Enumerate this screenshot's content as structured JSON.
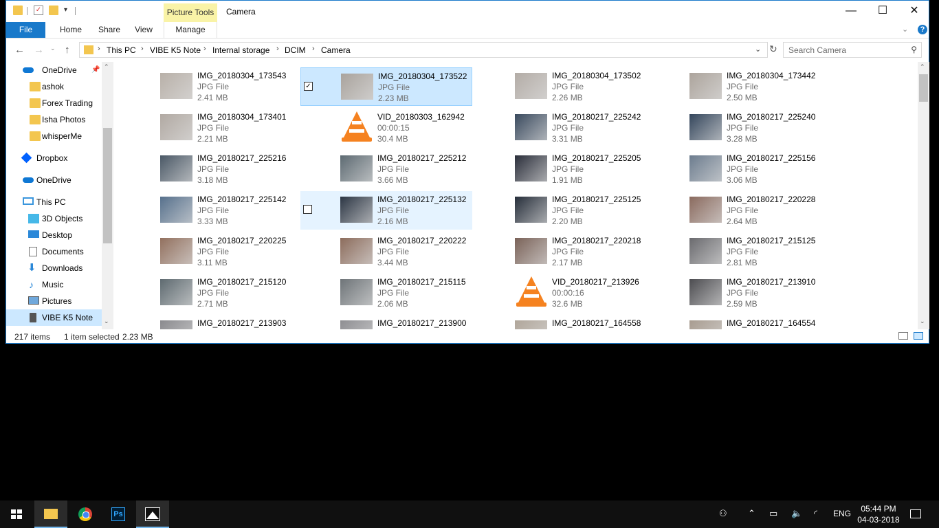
{
  "window": {
    "title": "Camera",
    "context_tab": "Picture Tools",
    "controls": {
      "minimize": "—",
      "maximize": "☐",
      "close": "✕"
    }
  },
  "ribbon": {
    "tabs": [
      "File",
      "Home",
      "Share",
      "View",
      "Manage"
    ]
  },
  "address": {
    "crumbs": [
      "This PC",
      "VIBE K5 Note",
      "Internal storage",
      "DCIM",
      "Camera"
    ],
    "separator": "›"
  },
  "search": {
    "placeholder": "Search Camera"
  },
  "nav": {
    "items": [
      {
        "label": "OneDrive",
        "icon": "cloud-icon",
        "pinned": true
      },
      {
        "label": "ashok",
        "icon": "folder-icon"
      },
      {
        "label": "Forex Trading",
        "icon": "folder-icon"
      },
      {
        "label": "Isha Photos",
        "icon": "folder-icon"
      },
      {
        "label": "whisperMe",
        "icon": "folder-icon"
      },
      {
        "label": "Dropbox",
        "icon": "dropbox-icon"
      },
      {
        "label": "OneDrive",
        "icon": "cloud-icon"
      },
      {
        "label": "This PC",
        "icon": "computer-icon"
      },
      {
        "label": "3D Objects",
        "icon": "cube-icon"
      },
      {
        "label": "Desktop",
        "icon": "desktop-icon"
      },
      {
        "label": "Documents",
        "icon": "document-icon"
      },
      {
        "label": "Downloads",
        "icon": "download-icon"
      },
      {
        "label": "Music",
        "icon": "music-icon"
      },
      {
        "label": "Pictures",
        "icon": "pictures-icon"
      },
      {
        "label": "VIBE K5 Note",
        "icon": "phone-icon",
        "selected": true
      }
    ]
  },
  "files": [
    {
      "name": "IMG_20180304_173543",
      "type": "JPG File",
      "size": "2.41 MB",
      "thumb": "#b8b0a8"
    },
    {
      "name": "IMG_20180304_173522",
      "type": "JPG File",
      "size": "2.23 MB",
      "thumb": "#a9a39d",
      "selected": true
    },
    {
      "name": "IMG_20180304_173502",
      "type": "JPG File",
      "size": "2.26 MB",
      "thumb": "#b3aca6"
    },
    {
      "name": "IMG_20180304_173442",
      "type": "JPG File",
      "size": "2.50 MB",
      "thumb": "#aca49c"
    },
    {
      "name": "IMG_20180304_173401",
      "type": "JPG File",
      "size": "2.21 MB",
      "thumb": "#b1a9a2"
    },
    {
      "name": "VID_20180303_162942",
      "type": "00:00:15",
      "size": "30.4 MB",
      "video": true
    },
    {
      "name": "IMG_20180217_225242",
      "type": "JPG File",
      "size": "3.31 MB",
      "thumb": "#3a4a5e"
    },
    {
      "name": "IMG_20180217_225240",
      "type": "JPG File",
      "size": "3.28 MB",
      "thumb": "#34465c"
    },
    {
      "name": "IMG_20180217_225216",
      "type": "JPG File",
      "size": "3.18 MB",
      "thumb": "#4a5866"
    },
    {
      "name": "IMG_20180217_225212",
      "type": "JPG File",
      "size": "3.66 MB",
      "thumb": "#5d6a72"
    },
    {
      "name": "IMG_20180217_225205",
      "type": "JPG File",
      "size": "1.91 MB",
      "thumb": "#2a2e3a"
    },
    {
      "name": "IMG_20180217_225156",
      "type": "JPG File",
      "size": "3.06 MB",
      "thumb": "#6c7c8e"
    },
    {
      "name": "IMG_20180217_225142",
      "type": "JPG File",
      "size": "3.33 MB",
      "thumb": "#56708c"
    },
    {
      "name": "IMG_20180217_225132",
      "type": "JPG File",
      "size": "2.16 MB",
      "thumb": "#2c3644",
      "hover": true
    },
    {
      "name": "IMG_20180217_225125",
      "type": "JPG File",
      "size": "2.20 MB",
      "thumb": "#262e3a"
    },
    {
      "name": "IMG_20180217_220228",
      "type": "JPG File",
      "size": "2.64 MB",
      "thumb": "#8a6a5e"
    },
    {
      "name": "IMG_20180217_220225",
      "type": "JPG File",
      "size": "3.11 MB",
      "thumb": "#92705e"
    },
    {
      "name": "IMG_20180217_220222",
      "type": "JPG File",
      "size": "3.44 MB",
      "thumb": "#8c6c5c"
    },
    {
      "name": "IMG_20180217_220218",
      "type": "JPG File",
      "size": "2.17 MB",
      "thumb": "#7a6258"
    },
    {
      "name": "IMG_20180217_215125",
      "type": "JPG File",
      "size": "2.81 MB",
      "thumb": "#6a6a6e"
    },
    {
      "name": "IMG_20180217_215120",
      "type": "JPG File",
      "size": "2.71 MB",
      "thumb": "#5e6a70"
    },
    {
      "name": "IMG_20180217_215115",
      "type": "JPG File",
      "size": "2.06 MB",
      "thumb": "#6e7478"
    },
    {
      "name": "VID_20180217_213926",
      "type": "00:00:16",
      "size": "32.6 MB",
      "video": true
    },
    {
      "name": "IMG_20180217_213910",
      "type": "JPG File",
      "size": "2.59 MB",
      "thumb": "#4c4c50"
    },
    {
      "name": "IMG_20180217_213903",
      "type": "",
      "size": "",
      "thumb": "#8a8a8e"
    },
    {
      "name": "IMG_20180217_213900",
      "type": "",
      "size": "",
      "thumb": "#8e8e92"
    },
    {
      "name": "IMG_20180217_164558",
      "type": "",
      "size": "",
      "thumb": "#b0a69a"
    },
    {
      "name": "IMG_20180217_164554",
      "type": "",
      "size": "",
      "thumb": "#a89c90"
    }
  ],
  "status": {
    "count": "217 items",
    "selection": "1 item selected",
    "selection_size": "2.23 MB"
  },
  "taskbar": {
    "apps": [
      "windows-start-icon",
      "file-explorer-icon",
      "chrome-icon",
      "photoshop-icon",
      "photos-icon"
    ],
    "ps_label": "Ps",
    "lang": "ENG",
    "time": "05:44 PM",
    "date": "04-03-2018"
  },
  "colors": {
    "accent": "#1979ca",
    "selection": "#cce8ff",
    "context_tab": "#f9f3a7"
  }
}
